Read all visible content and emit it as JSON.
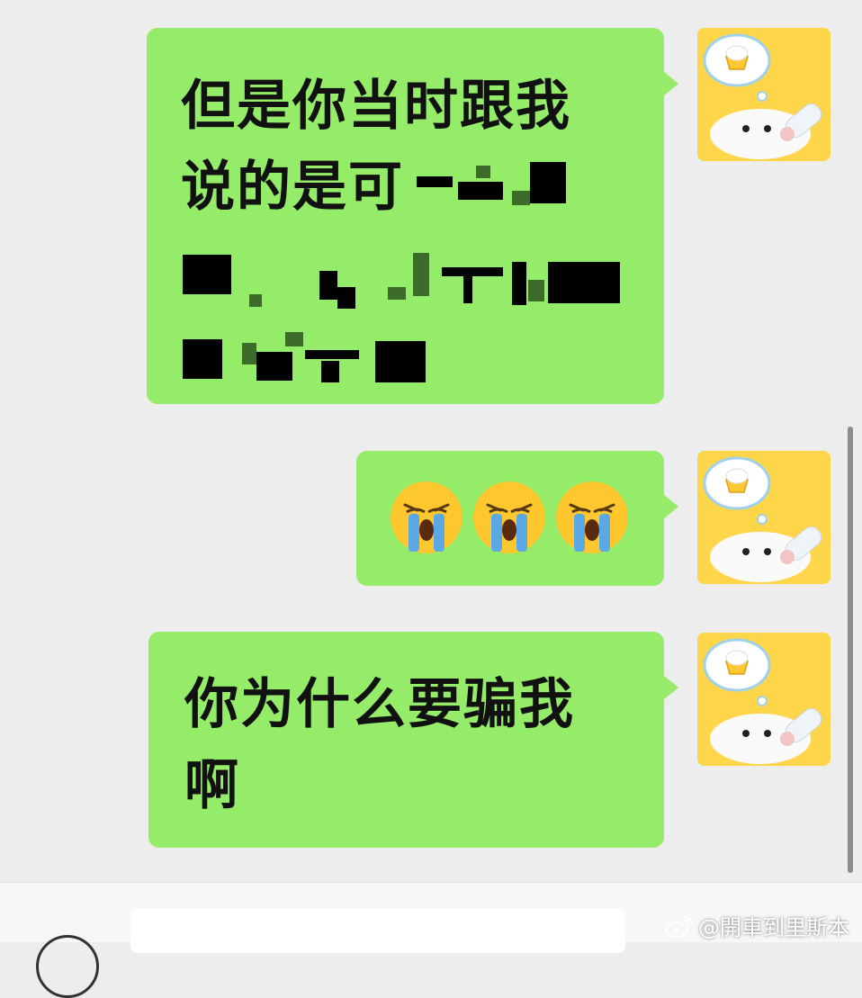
{
  "messages": [
    {
      "id": "msg-1",
      "text_line1": "但是你当时跟我",
      "text_line2": "说的是可",
      "redacted": true
    },
    {
      "id": "msg-2",
      "emojis": [
        "loudly-crying-face",
        "loudly-crying-face",
        "loudly-crying-face"
      ]
    },
    {
      "id": "msg-3",
      "text_line1": "你为什么要骗我",
      "text_line2": "啊"
    }
  ],
  "avatar": {
    "icon": "cartoon-seal-with-bottle-avatar"
  },
  "watermark": {
    "text": "@開車到里斯本",
    "icon": "weibo-logo-icon"
  },
  "colors": {
    "bubble": "#95ec69",
    "background": "#ededed",
    "avatar_bg": "#ffd54a"
  }
}
